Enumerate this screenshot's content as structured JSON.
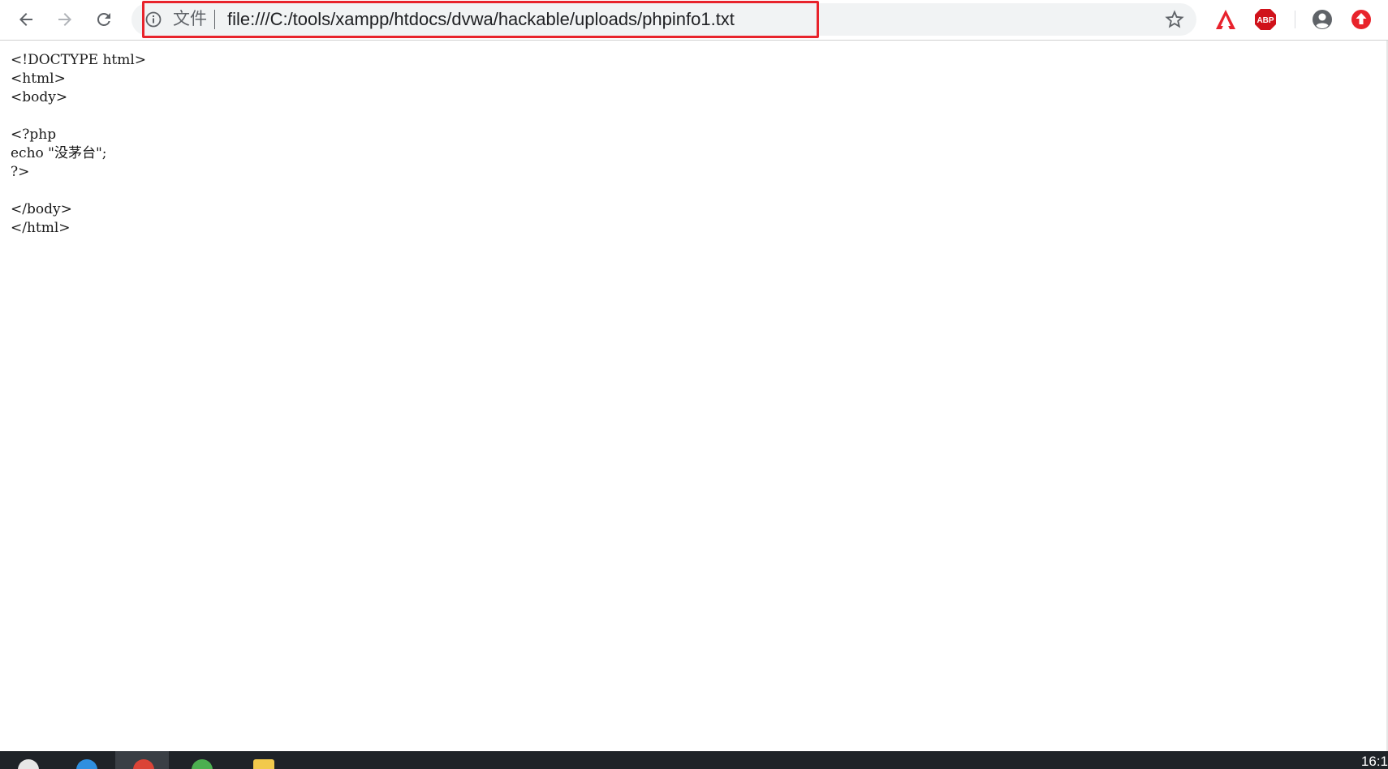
{
  "toolbar": {
    "back_icon": "back-arrow-icon",
    "forward_icon": "forward-arrow-icon",
    "reload_icon": "reload-icon",
    "omnibox": {
      "scheme_label": "文件",
      "url": "file:///C:/tools/xampp/htdocs/dvwa/hackable/uploads/phpinfo1.txt",
      "info_icon": "info-icon",
      "bookmark_icon": "star-icon",
      "highlight_color": "#e8232b"
    },
    "extensions": [
      {
        "name": "adobe-acrobat-icon",
        "color": "#e8222d"
      },
      {
        "name": "adblock-plus-icon",
        "label": "ABP",
        "color": "#d0121b"
      }
    ],
    "profile_icon": "account-circle-icon",
    "update_icon": "update-arrow-icon",
    "update_color": "#e8232b"
  },
  "page": {
    "lines": [
      "<!DOCTYPE html>",
      "<html>",
      "<body>",
      "",
      "<?php",
      "echo \"没茅台\";",
      "?>",
      "",
      "</body>",
      "</html>"
    ]
  },
  "taskbar": {
    "clock": "16:1",
    "background": "#1f2328"
  }
}
